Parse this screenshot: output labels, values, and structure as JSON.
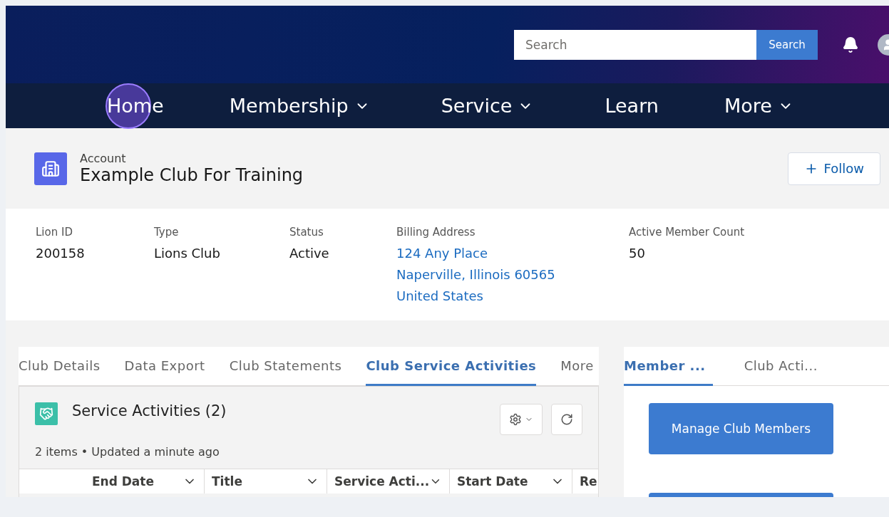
{
  "header": {
    "search": {
      "placeholder": "Search"
    },
    "search_button": "Search"
  },
  "nav": {
    "items": [
      {
        "label": "Home",
        "has_menu": false,
        "clicked": true
      },
      {
        "label": "Membership",
        "has_menu": true,
        "clicked": false
      },
      {
        "label": "Service",
        "has_menu": true,
        "clicked": false
      },
      {
        "label": "Learn",
        "has_menu": false,
        "clicked": false
      },
      {
        "label": "More",
        "has_menu": true,
        "clicked": false
      }
    ]
  },
  "record": {
    "object": "Account",
    "name": "Example Club For Training",
    "follow_button": "Follow"
  },
  "fields": [
    {
      "label": "Lion ID",
      "lines": [
        "200158"
      ],
      "link": false
    },
    {
      "label": "Type",
      "lines": [
        "Lions Club"
      ],
      "link": false
    },
    {
      "label": "Status",
      "lines": [
        "Active"
      ],
      "link": false
    },
    {
      "label": "Billing Address",
      "lines": [
        "124 Any Place",
        "Naperville, Illinois 60565",
        "United States"
      ],
      "link": true
    },
    {
      "label": "Active Member Count",
      "lines": [
        "50"
      ],
      "link": false
    }
  ],
  "main_tabs": [
    {
      "label": "Club Details",
      "selected": false
    },
    {
      "label": "Data Export",
      "selected": false
    },
    {
      "label": "Club Statements",
      "selected": false
    },
    {
      "label": "Club Service Activities",
      "selected": true
    },
    {
      "label": "More",
      "selected": false
    }
  ],
  "related_list": {
    "title": "Service Activities (2)",
    "subtitle": "2 items • Updated a minute ago",
    "columns": [
      {
        "label": "End Date",
        "sortable": true
      },
      {
        "label": "Title",
        "sortable": true
      },
      {
        "label": "Service Acti...",
        "sortable": true
      },
      {
        "label": "Start Date",
        "sortable": true
      },
      {
        "label": "Re"
      }
    ]
  },
  "side_tabs": [
    {
      "label": "Member ...",
      "selected": true
    },
    {
      "label": "Club Acti...",
      "selected": false
    }
  ],
  "side_buttons": [
    {
      "label": "Manage Club Members"
    }
  ]
}
